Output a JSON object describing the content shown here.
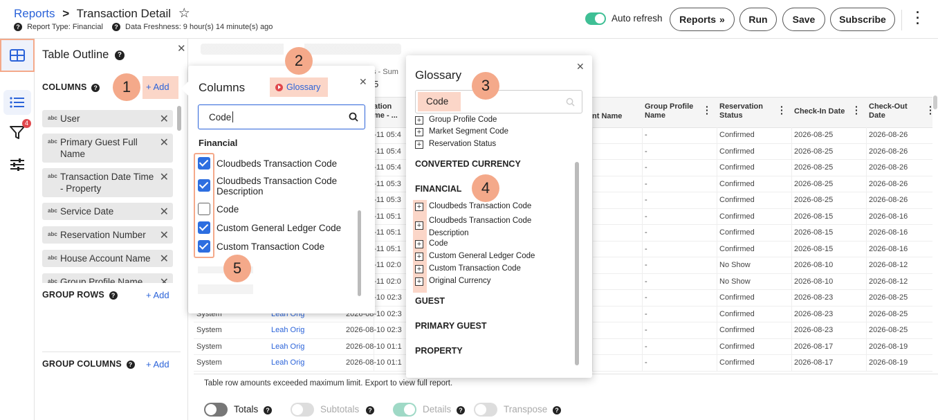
{
  "header": {
    "breadcrumb_root": "Reports",
    "breadcrumb_sep": ">",
    "title": "Transaction Detail",
    "report_type": "Report Type: Financial",
    "freshness": "Data Freshness: 9 hour(s) 14 minute(s) ago",
    "auto_refresh_label": "Auto refresh",
    "buttons": {
      "reports": "Reports",
      "run": "Run",
      "save": "Save",
      "subscribe": "Subscribe"
    }
  },
  "sidebar": {
    "filter_badge": "4"
  },
  "outline": {
    "title": "Table Outline",
    "columns_label": "COLUMNS",
    "add_label": "+ Add",
    "chip_prefix": "abc",
    "columns": [
      "User",
      "Primary Guest Full Name",
      "Transaction Date Time - Property",
      "Service Date",
      "Reservation Number",
      "House Account Name",
      "Group Profile Name"
    ],
    "group_rows_label": "GROUP ROWS",
    "group_columns_label": "GROUP COLUMNS"
  },
  "columns_popup": {
    "title": "Columns",
    "glossary_label": "Glossary",
    "search_value": "Code",
    "section": "Financial",
    "items": [
      {
        "label": "Cloudbeds Transaction Code",
        "checked": true
      },
      {
        "label": "Cloudbeds Transaction Code Description",
        "checked": true
      },
      {
        "label": "Code",
        "checked": false
      },
      {
        "label": "Custom General Ledger Code",
        "checked": true
      },
      {
        "label": "Custom Transaction Code",
        "checked": true
      }
    ]
  },
  "glossary": {
    "title": "Glossary",
    "search_value": "Code",
    "top_items": [
      "Group Profile Code",
      "Market Segment Code",
      "Reservation Status"
    ],
    "categories": [
      "CONVERTED CURRENCY",
      "FINANCIAL",
      "GUEST",
      "PRIMARY GUEST",
      "PROPERTY"
    ],
    "financial_items": [
      "Cloudbeds Transaction Code",
      "Cloudbeds Transaction Code Description",
      "Code",
      "Custom General Ledger Code",
      "Custom Transaction Code",
      "Original Currency"
    ]
  },
  "callouts": [
    "1",
    "2",
    "3",
    "4",
    "5"
  ],
  "table": {
    "subtitle_fragment": "s - Sum",
    "subtitle_fragment2": "5",
    "headers": [
      "ation\nme - ...",
      "nt Name",
      "Group Profile Name",
      "Reservation Status",
      "Check-In Date",
      "Check-Out Date"
    ],
    "rows": [
      {
        "u": "",
        "g": "",
        "tdt": "2026-08-11 05:4",
        "grp": "-",
        "status": "Confirmed",
        "in": "2026-08-25",
        "out": "2026-08-26"
      },
      {
        "u": "",
        "g": "",
        "tdt": "2026-08-11 05:4",
        "grp": "-",
        "status": "Confirmed",
        "in": "2026-08-25",
        "out": "2026-08-26"
      },
      {
        "u": "",
        "g": "",
        "tdt": "2026-08-11 05:4",
        "grp": "-",
        "status": "Confirmed",
        "in": "2026-08-25",
        "out": "2026-08-26"
      },
      {
        "u": "",
        "g": "",
        "tdt": "2026-08-11 05:3",
        "grp": "-",
        "status": "Confirmed",
        "in": "2026-08-25",
        "out": "2026-08-26"
      },
      {
        "u": "",
        "g": "",
        "tdt": "2026-08-11 05:3",
        "grp": "-",
        "status": "Confirmed",
        "in": "2026-08-25",
        "out": "2026-08-26"
      },
      {
        "u": "",
        "g": "",
        "tdt": "2026-08-11 05:1",
        "grp": "-",
        "status": "Confirmed",
        "in": "2026-08-15",
        "out": "2026-08-16"
      },
      {
        "u": "",
        "g": "",
        "tdt": "2026-08-11 05:1",
        "grp": "-",
        "status": "Confirmed",
        "in": "2026-08-15",
        "out": "2026-08-16"
      },
      {
        "u": "",
        "g": "",
        "tdt": "2026-08-11 05:1",
        "grp": "-",
        "status": "Confirmed",
        "in": "2026-08-15",
        "out": "2026-08-16"
      },
      {
        "u": "",
        "g": "",
        "tdt": "2026-08-11 02:0",
        "grp": "-",
        "status": "No Show",
        "in": "2026-08-10",
        "out": "2026-08-12"
      },
      {
        "u": "",
        "g": "",
        "tdt": "2026-08-11 02:0",
        "grp": "-",
        "status": "No Show",
        "in": "2026-08-10",
        "out": "2026-08-12"
      },
      {
        "u": "",
        "g": "",
        "tdt": "2026-08-10 02:3",
        "grp": "-",
        "status": "Confirmed",
        "in": "2026-08-23",
        "out": "2026-08-25"
      },
      {
        "u": "System",
        "g": "Leah Orig",
        "tdt": "2026-08-10 02:3",
        "grp": "-",
        "status": "Confirmed",
        "in": "2026-08-23",
        "out": "2026-08-25"
      },
      {
        "u": "System",
        "g": "Leah Orig",
        "tdt": "2026-08-10 02:3",
        "grp": "-",
        "status": "Confirmed",
        "in": "2026-08-23",
        "out": "2026-08-25"
      },
      {
        "u": "System",
        "g": "Leah Orig",
        "tdt": "2026-08-10 01:1",
        "grp": "-",
        "status": "Confirmed",
        "in": "2026-08-17",
        "out": "2026-08-19"
      },
      {
        "u": "System",
        "g": "Leah Orig",
        "tdt": "2026-08-10 01:1",
        "grp": "-",
        "status": "Confirmed",
        "in": "2026-08-17",
        "out": "2026-08-19"
      }
    ],
    "footer_note": "Table row amounts exceeded maximum limit. Export to view full report."
  },
  "bottom_toggles": [
    {
      "label": "Totals",
      "state": "off"
    },
    {
      "label": "Subtotals",
      "state": "disabled"
    },
    {
      "label": "Details",
      "state": "on"
    },
    {
      "label": "Transpose",
      "state": "disabled"
    }
  ],
  "colors": {
    "accent_blue": "#2b63d9",
    "callout": "#f4a98a",
    "toggle_green": "#3fbf95"
  }
}
